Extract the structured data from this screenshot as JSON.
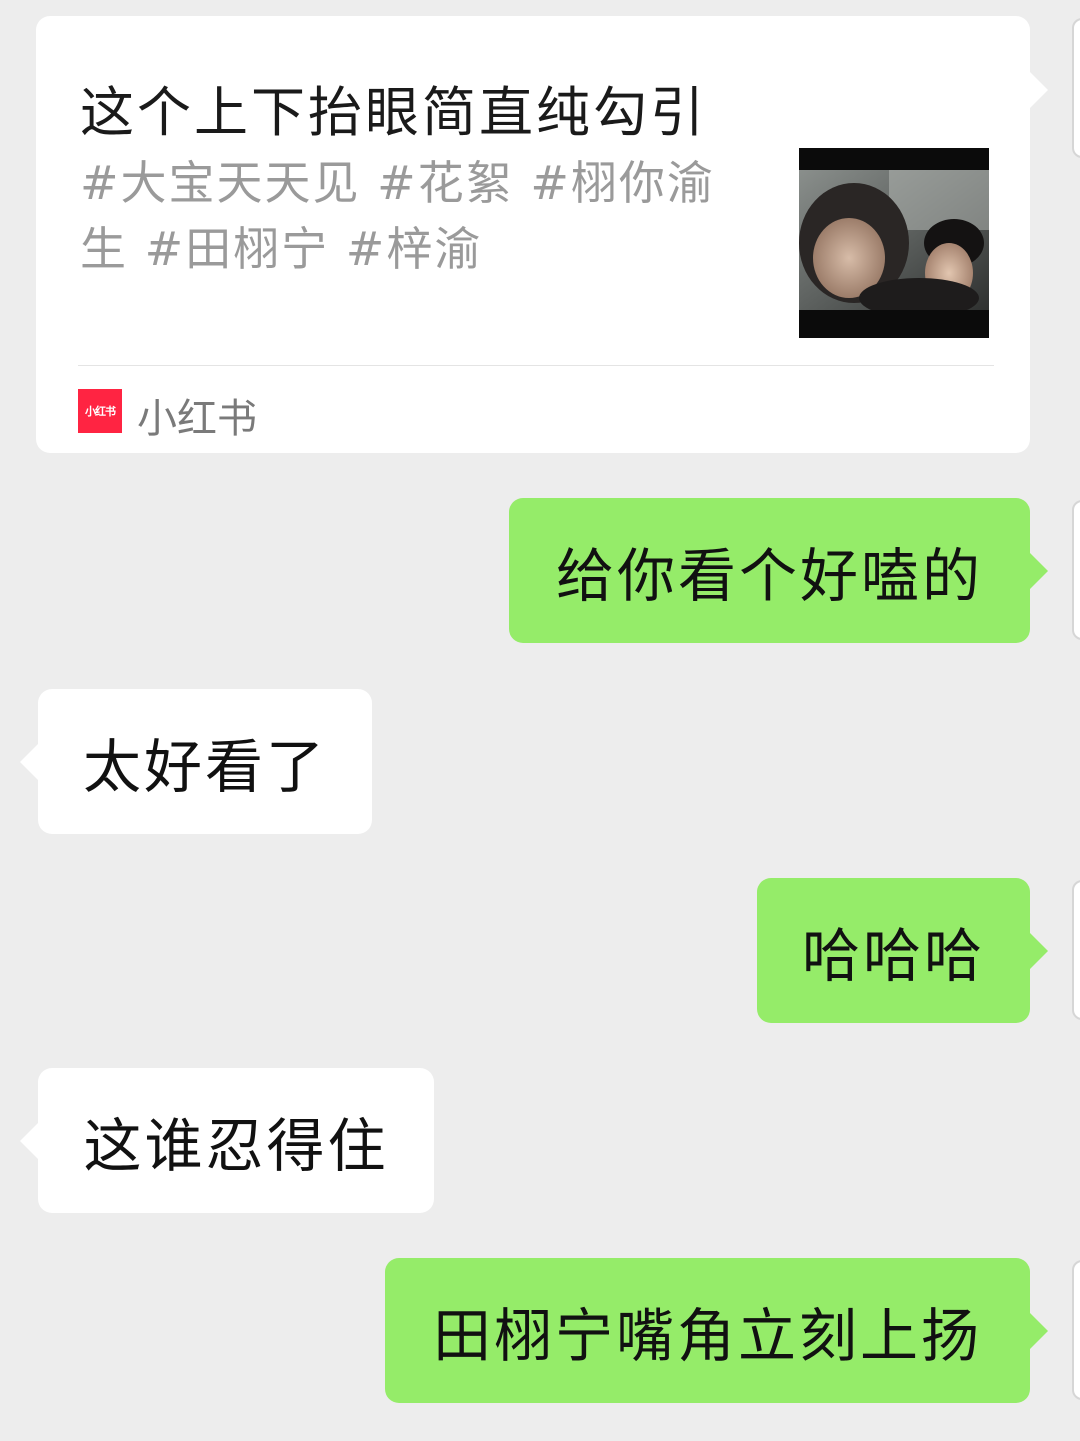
{
  "colors": {
    "background": "#ededed",
    "sent_bubble": "#95ec69",
    "received_bubble": "#ffffff",
    "source_brand": "#ff2442"
  },
  "shared_card": {
    "title": "这个上下抬眼简直纯勾引",
    "description": "#大宝天天见 #花絮 #栩你渝生 #田栩宁 #梓渝",
    "thumbnail": "video-thumbnail",
    "source_logo_text": "小红书",
    "source_name": "小红书"
  },
  "messages": [
    {
      "side": "right",
      "text": "给你看个好嗑的"
    },
    {
      "side": "left",
      "text": "太好看了"
    },
    {
      "side": "right",
      "text": "哈哈哈"
    },
    {
      "side": "left",
      "text": "这谁忍得住"
    },
    {
      "side": "right",
      "text": "田栩宁嘴角立刻上扬"
    }
  ]
}
